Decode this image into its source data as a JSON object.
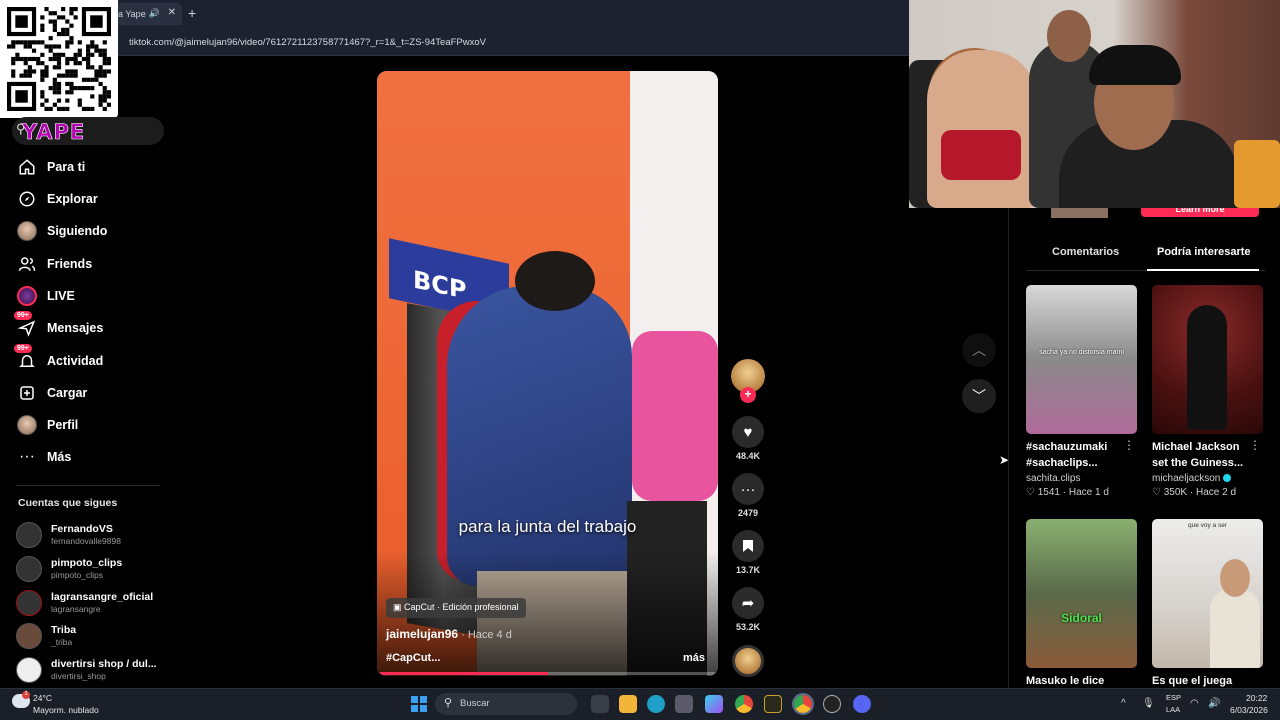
{
  "browser": {
    "tab_title": "a Yape",
    "new_tab_symbol": "+",
    "tab_close_symbol": "✕",
    "url": "tiktok.com/@jaimelujan96/video/7612721123758771467?_r=1&_t=ZS-94TeaFPwxoV"
  },
  "overlay": {
    "brand_text": "YAPE",
    "brand_color": "#b300b3"
  },
  "sidebar": {
    "items": [
      {
        "label": "Para ti",
        "icon": "home-icon"
      },
      {
        "label": "Explorar",
        "icon": "compass-icon"
      },
      {
        "label": "Siguiendo",
        "icon": "avatar"
      },
      {
        "label": "Friends",
        "icon": "friends-icon"
      },
      {
        "label": "LIVE",
        "icon": "live-avatar"
      },
      {
        "label": "Mensajes",
        "icon": "paper-plane-icon",
        "badge": "99+"
      },
      {
        "label": "Actividad",
        "icon": "bell-icon",
        "badge": "99+"
      },
      {
        "label": "Cargar",
        "icon": "upload-icon"
      },
      {
        "label": "Perfil",
        "icon": "avatar"
      },
      {
        "label": "Más",
        "icon": "more-icon"
      }
    ],
    "following_title": "Cuentas que sigues",
    "following": [
      {
        "name": "FernandoVS",
        "handle": "fernandovalle9898"
      },
      {
        "name": "pimpoto_clips",
        "handle": "pimpoto_clips"
      },
      {
        "name": "lagransangre_oficial",
        "handle": "lagransangre"
      },
      {
        "name": "Triba",
        "handle": "_triba"
      },
      {
        "name": "divertirsi shop / dul...",
        "handle": "divertirsi_shop"
      }
    ]
  },
  "video": {
    "caption": "para la junta del trabajo",
    "sign_text": "BCP",
    "capcut_label": "CapCut · Edición profesional",
    "author": "jaimelujan96",
    "posted": " · Hace 4 d",
    "hashtag": "#CapCut...",
    "more": "más",
    "progress": 0.5,
    "accent_color": "#fe2c55"
  },
  "actions": {
    "likes": "48.4K",
    "comments": "2479",
    "saves": "13.7K",
    "shares": "53.2K"
  },
  "panel": {
    "learn_more": "Learn more",
    "tabs": [
      "Comentarios",
      "Podría interesarte"
    ],
    "cards": [
      {
        "title": "#sachauzumaki #sachaclips...",
        "user": "sachita.clips",
        "likes": "1541",
        "ago": "Hace 1 d",
        "verified": false,
        "thumb_text": "sacha ya no distorsia mami"
      },
      {
        "title": "Michael Jackson set the Guiness...",
        "user": "michaeljackson",
        "likes": "350K",
        "ago": "Hace 2 d",
        "verified": true,
        "thumb_text": ""
      },
      {
        "title": "Masuko le dice",
        "user": "",
        "likes": "",
        "ago": "",
        "verified": false,
        "thumb_text": "Sidoral"
      },
      {
        "title": "Es que el juega",
        "user": "",
        "likes": "",
        "ago": "",
        "verified": false,
        "thumb_text": "que voy a ser"
      }
    ]
  },
  "taskbar": {
    "temperature": "24°C",
    "weather": "Mayorm. nublado",
    "search_placeholder": "Buscar",
    "lang_top": "ESP",
    "lang_bottom": "LAA",
    "time": "20:22",
    "date": "6/03/2026"
  }
}
